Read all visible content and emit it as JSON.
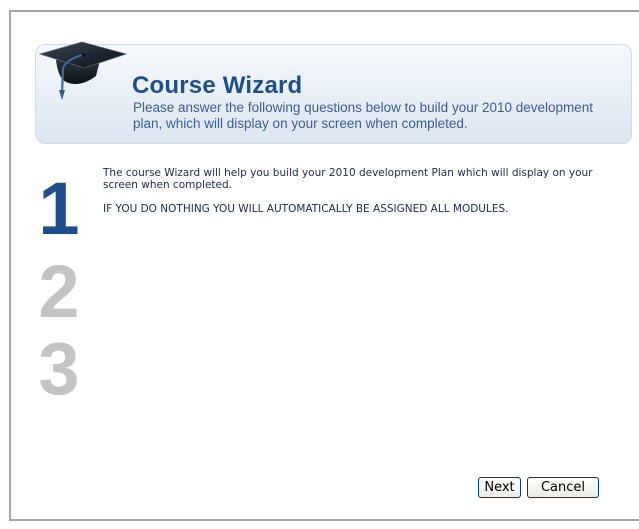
{
  "header": {
    "icon": "graduation-cap-icon",
    "title": "Course Wizard",
    "subtitle": "Please answer the following questions below to build your 2010 development plan, which will display on your screen when completed."
  },
  "steps": {
    "items": [
      {
        "number": "1",
        "active": true
      },
      {
        "number": "2",
        "active": false
      },
      {
        "number": "3",
        "active": false
      }
    ],
    "active_color": "#1f4e8c",
    "inactive_color": "#c4c4c4"
  },
  "content": {
    "intro": "The course Wizard will help you build your 2010 development Plan which will display on your screen when completed.",
    "notice": "IF YOU DO NOTHING YOU WILL AUTOMATICALLY BE ASSIGNED ALL MODULES."
  },
  "buttons": {
    "next_label": "Next",
    "cancel_label": "Cancel"
  }
}
